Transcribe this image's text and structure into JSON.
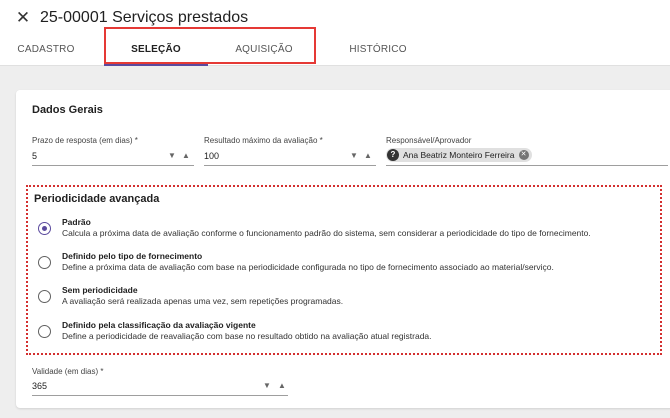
{
  "header": {
    "title": "25-00001 Serviços prestados",
    "tabs": [
      {
        "label": "CADASTRO"
      },
      {
        "label": "SELEÇÃO"
      },
      {
        "label": "AQUISIÇÃO"
      },
      {
        "label": "HISTÓRICO"
      }
    ],
    "active_tab": "SELEÇÃO"
  },
  "dados_gerais": {
    "title": "Dados Gerais",
    "prazo": {
      "label": "Prazo de resposta (em dias) *",
      "value": "5"
    },
    "resultado": {
      "label": "Resultado máximo da avaliação *",
      "value": "100"
    },
    "responsavel": {
      "label": "Responsável/Aprovador",
      "avatar": "?",
      "chip": "Ana Beatriz Monteiro Ferreira"
    }
  },
  "periodicidade": {
    "title": "Periodicidade avançada",
    "selected": "Padrão",
    "options": [
      {
        "title": "Padrão",
        "desc": "Calcula a próxima data de avaliação conforme o funcionamento padrão do sistema, sem considerar a periodicidade do tipo de fornecimento."
      },
      {
        "title": "Definido pelo tipo de fornecimento",
        "desc": "Define a próxima data de avaliação com base na periodicidade configurada no tipo de fornecimento associado ao material/serviço."
      },
      {
        "title": "Sem periodicidade",
        "desc": "A avaliação será realizada apenas uma vez, sem repetições programadas."
      },
      {
        "title": "Definido pela classificação da avaliação vigente",
        "desc": "Define a periodicidade de reavaliação com base no resultado obtido na avaliação atual registrada."
      }
    ]
  },
  "validade": {
    "label": "Validade (em dias) *",
    "value": "365"
  },
  "icons": {
    "close": "close-icon",
    "decrement": "arrow-down-icon",
    "increment": "arrow-up-icon",
    "chip_remove": "remove-chip-icon",
    "avatar": "help-avatar-icon"
  },
  "colors": {
    "accent": "#5b4a9e",
    "highlight_border": "#e53935",
    "dotted_border": "#d32f2f"
  }
}
